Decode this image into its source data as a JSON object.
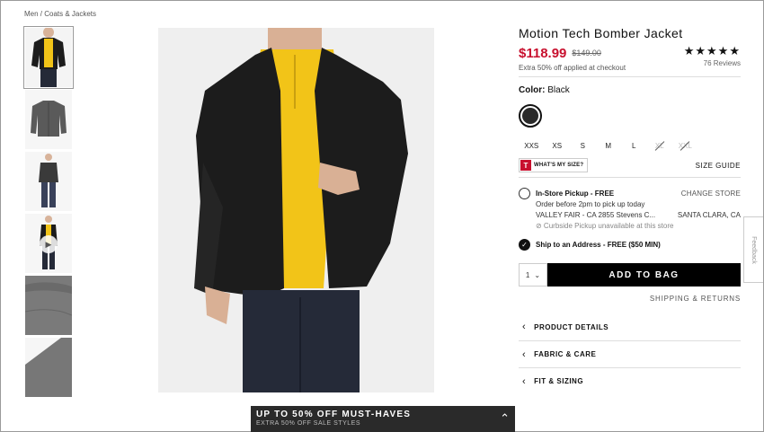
{
  "breadcrumb": "Men / Coats & Jackets",
  "product": {
    "title": "Motion Tech Bomber Jacket",
    "price": "$118.99",
    "old_price": "$149.00",
    "promo": "Extra 50% off applied at checkout",
    "stars": "★★★★★",
    "reviews": "76 Reviews",
    "color_label": "Color:",
    "color_value": "Black"
  },
  "sizes": [
    {
      "label": "XXS",
      "available": true
    },
    {
      "label": "XS",
      "available": true
    },
    {
      "label": "S",
      "available": true
    },
    {
      "label": "M",
      "available": true
    },
    {
      "label": "L",
      "available": true
    },
    {
      "label": "XL",
      "available": false
    },
    {
      "label": "XXL",
      "available": false
    }
  ],
  "fit": {
    "logo": "T",
    "label": "WHAT'S MY SIZE?",
    "size_guide": "SIZE GUIDE"
  },
  "pickup": {
    "title": "In-Store Pickup - FREE",
    "change_store": "CHANGE STORE",
    "order_before": "Order before 2pm to pick up today",
    "store_name": "VALLEY FAIR - CA 2855 Stevens C...",
    "store_city": "SANTA CLARA, CA",
    "curbside": "⊘ Curbside Pickup unavailable at this store"
  },
  "ship": {
    "title": "Ship to an Address - FREE ($50 MIN)"
  },
  "bag": {
    "qty": "1",
    "add_label": "ADD TO BAG",
    "shipping_returns": "SHIPPING & RETURNS"
  },
  "accordion": [
    "PRODUCT DETAILS",
    "FABRIC & CARE",
    "FIT & SIZING"
  ],
  "feedback": "Feedback",
  "banner": {
    "title": "UP TO 50% OFF MUST-HAVES",
    "subtitle": "EXTRA 50% OFF SALE STYLES"
  },
  "colors": {
    "sale_red": "#c8102e",
    "jacket": "#1c1c1c",
    "shirt_yellow": "#f2c418",
    "jeans": "#252a38",
    "banner": "#2a2a2a"
  }
}
